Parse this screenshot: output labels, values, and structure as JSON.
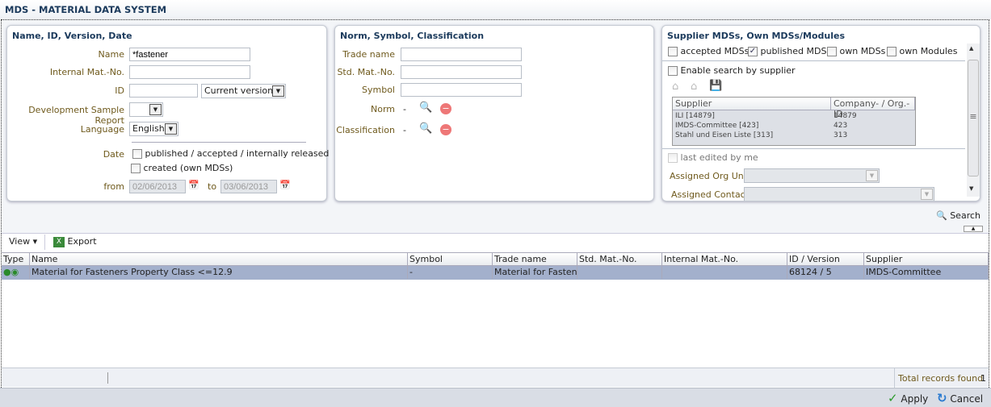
{
  "app": {
    "title": "MDS - MATERIAL DATA SYSTEM"
  },
  "panel1": {
    "title": "Name, ID, Version, Date",
    "name_label": "Name",
    "name_value": "*fastener",
    "internal_label": "Internal Mat.-No.",
    "internal_value": "",
    "id_label": "ID",
    "id_value": "",
    "versions_value": "Current versions",
    "dsr_label": "Development Sample Report",
    "dsr_value": "",
    "language_label": "Language",
    "language_value": "English",
    "date_label": "Date",
    "published_label": "published / accepted / internally released",
    "created_label": "created (own MDSs)",
    "from_label": "from",
    "from_value": "02/06/2013",
    "to_label": "to",
    "to_value": "03/06/2013"
  },
  "panel2": {
    "title": "Norm, Symbol, Classification",
    "trade_label": "Trade name",
    "std_label": "Std. Mat.-No.",
    "symbol_label": "Symbol",
    "norm_label": "Norm",
    "norm_value": "-",
    "class_label": "Classification",
    "class_value": "-"
  },
  "panel3": {
    "title": "Supplier MDSs, Own MDSs/Modules",
    "accepted": "accepted MDSs",
    "published": "published MDSs",
    "published_checked": true,
    "own_mdss": "own MDSs",
    "own_modules": "own Modules",
    "enable_supplier": "Enable search by supplier",
    "sup_headers": [
      "Supplier",
      "Company- / Org.-ID"
    ],
    "suppliers": [
      {
        "name": "ILI [14879]",
        "id": "14879"
      },
      {
        "name": "IMDS-Committee [423]",
        "id": "423"
      },
      {
        "name": "Stahl und Eisen Liste [313]",
        "id": "313"
      }
    ],
    "last_edited": "last edited by me",
    "org_unit_label": "Assigned Org Unit",
    "contact_label": "Assigned Contact"
  },
  "search_label": "Search",
  "toolbar": {
    "view": "View",
    "export": "Export"
  },
  "table": {
    "headers": [
      "Type",
      "Name",
      "Symbol",
      "Trade name",
      "Std. Mat.-No.",
      "Internal Mat.-No.",
      "ID / Version",
      "Supplier"
    ],
    "rows": [
      [
        "",
        "Material for Fasteners Property Class <=12.9",
        "-",
        "Material for Fasten...",
        "",
        "",
        "68124 / 5",
        "IMDS-Committee"
      ]
    ]
  },
  "status": {
    "total_label": "Total records found",
    "total_value": "1"
  },
  "footer": {
    "apply": "Apply",
    "cancel": "Cancel"
  }
}
